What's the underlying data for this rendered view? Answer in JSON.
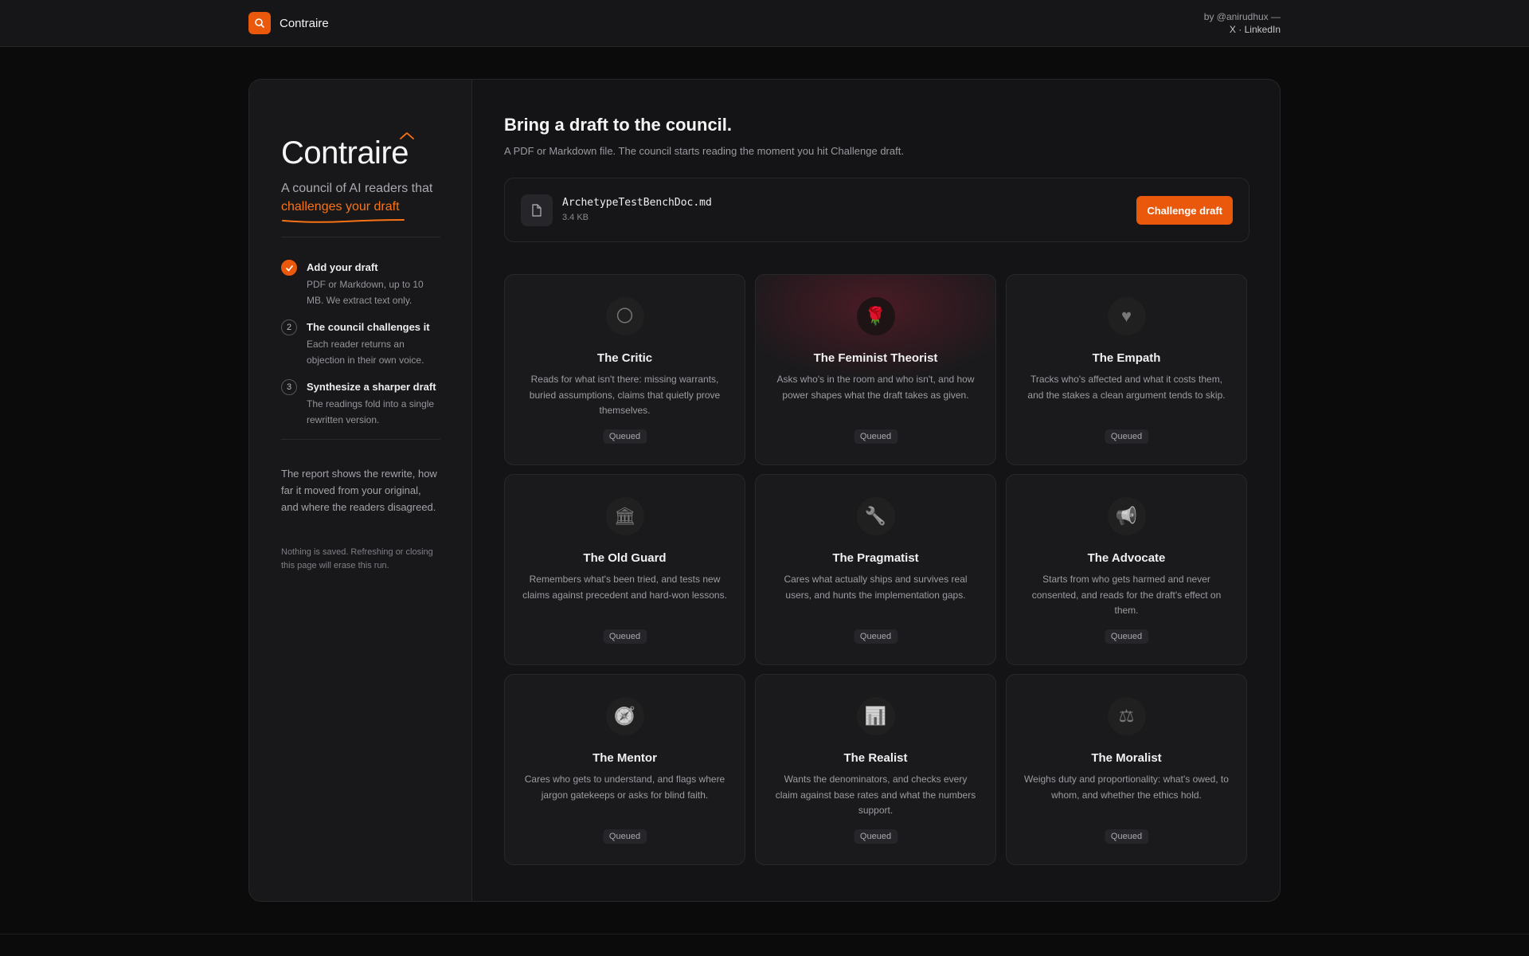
{
  "header": {
    "brand": "Contraire",
    "byline": "by @anirudhux —",
    "links": [
      "X",
      "LinkedIn"
    ],
    "link_separator": "·"
  },
  "sidebar": {
    "logo": "Contraire",
    "tagline": "A council of AI readers that",
    "tagline_accent": "challenges your draft",
    "steps": [
      {
        "num": "1",
        "title": "Add your draft",
        "desc": "PDF or Markdown, up to 10 MB. We extract text only.",
        "done": true
      },
      {
        "num": "2",
        "title": "The council challenges it",
        "desc": "Each reader returns an objection in their own voice.",
        "done": false
      },
      {
        "num": "3",
        "title": "Synthesize a sharper draft",
        "desc": "The readings fold into a single rewritten version.",
        "done": false
      }
    ],
    "note": "The report shows the rewrite, how far it moved from your original, and where the readers disagreed.",
    "fine_print": "Nothing is saved. Refreshing or closing this page will erase this run."
  },
  "main": {
    "heading": "Bring a draft to the council.",
    "subheading": "A PDF or Markdown file. The council starts reading the moment you hit Challenge draft.",
    "file": {
      "name": "ArchetypeTestBenchDoc.md",
      "size": "3.4 KB"
    },
    "cta_label": "Challenge draft"
  },
  "readers": [
    {
      "name": "The Critic",
      "icon": "🌕",
      "icon_name": "moon-icon",
      "desc": "Reads for what isn't there: missing warrants, buried assumptions, claims that quietly prove themselves.",
      "status": "Queued",
      "active": false
    },
    {
      "name": "The Feminist Theorist",
      "icon": "🌹",
      "icon_name": "rose-icon",
      "desc": "Asks who's in the room and who isn't, and how power shapes what the draft takes as given.",
      "status": "Queued",
      "active": true
    },
    {
      "name": "The Empath",
      "icon": "♥",
      "icon_name": "heart-icon",
      "desc": "Tracks who's affected and what it costs them, and the stakes a clean argument tends to skip.",
      "status": "Queued",
      "active": false
    },
    {
      "name": "The Old Guard",
      "icon": "🏛",
      "icon_name": "classical-building-icon",
      "desc": "Remembers what's been tried, and tests new claims against precedent and hard-won lessons.",
      "status": "Queued",
      "active": false
    },
    {
      "name": "The Pragmatist",
      "icon": "🔧",
      "icon_name": "wrench-icon",
      "desc": "Cares what actually ships and survives real users, and hunts the implementation gaps.",
      "status": "Queued",
      "active": false
    },
    {
      "name": "The Advocate",
      "icon": "📢",
      "icon_name": "megaphone-icon",
      "desc": "Starts from who gets harmed and never consented, and reads for the draft's effect on them.",
      "status": "Queued",
      "active": false
    },
    {
      "name": "The Mentor",
      "icon": "🧭",
      "icon_name": "compass-icon",
      "desc": "Cares who gets to understand, and flags where jargon gatekeeps or asks for blind faith.",
      "status": "Queued",
      "active": false
    },
    {
      "name": "The Realist",
      "icon": "📊",
      "icon_name": "bar-chart-icon",
      "desc": "Wants the denominators, and checks every claim against base rates and what the numbers support.",
      "status": "Queued",
      "active": false
    },
    {
      "name": "The Moralist",
      "icon": "⚖",
      "icon_name": "scales-icon",
      "desc": "Weighs duty and proportionality: what's owed, to whom, and whether the ethics hold.",
      "status": "Queued",
      "active": false
    }
  ],
  "colors": {
    "accent": "#ea580c",
    "background": "#0b0b0c",
    "panel": "#141416",
    "card": "#1a1a1c"
  }
}
